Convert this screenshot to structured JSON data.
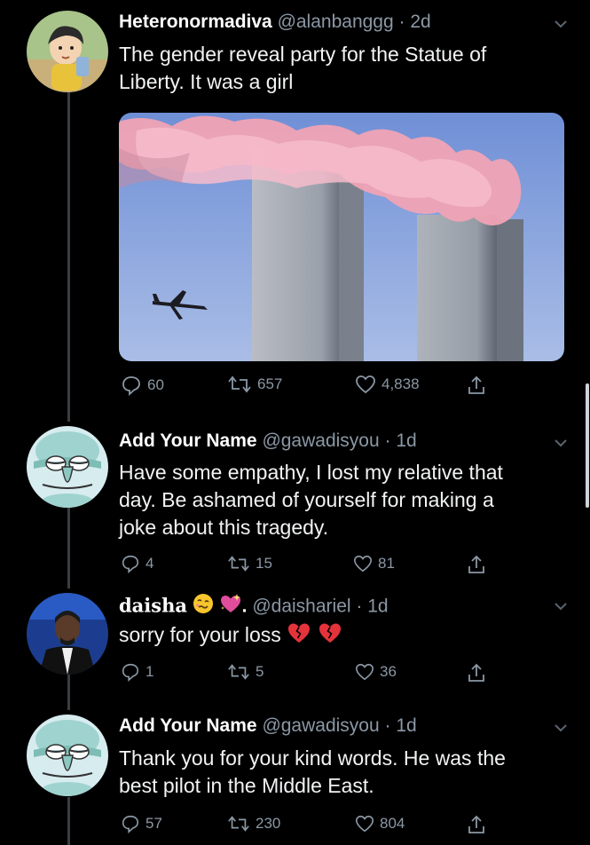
{
  "tweets": [
    {
      "name": "Heteronormadiva",
      "handle": "@alanbanggg",
      "time": "2d",
      "text_lines": [
        "The gender reveal party for the Statue of",
        "Liberty. It was a girl"
      ],
      "replies": "60",
      "retweets": "657",
      "likes": "4,838",
      "avatar_icon": "cartoon-boy-avatar",
      "media": "towers-pink-smoke-image"
    },
    {
      "name": "Add Your Name",
      "handle": "@gawadisyou",
      "time": "1d",
      "text_lines": [
        "Have some empathy, I lost my relative that",
        "day.  Be ashamed of yourself for making a",
        "joke about this tragedy."
      ],
      "replies": "4",
      "retweets": "15",
      "likes": "81",
      "avatar_icon": "squidward-avatar"
    },
    {
      "name": "daisha",
      "name_suffix": ".",
      "handle": "@daishariel",
      "time": "1d",
      "text_lines": [
        "sorry for your loss"
      ],
      "replies": "1",
      "retweets": "5",
      "likes": "36",
      "avatar_icon": "man-photo-avatar"
    },
    {
      "name": "Add Your Name",
      "handle": "@gawadisyou",
      "time": "1d",
      "text_lines": [
        "Thank you for your kind words. He was the",
        "best pilot in the Middle East."
      ],
      "replies": "57",
      "retweets": "230",
      "likes": "804",
      "avatar_icon": "squidward-avatar"
    }
  ],
  "separator": "·",
  "colors": {
    "background": "#000000",
    "text": "#e7e9ea",
    "muted": "#8b98a5",
    "thread_line": "#3a3d41"
  }
}
